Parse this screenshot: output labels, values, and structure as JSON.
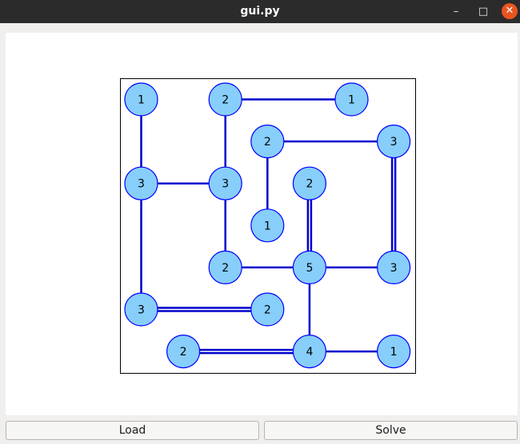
{
  "window": {
    "title": "gui.py",
    "minimize_glyph": "–",
    "maximize_glyph": "□",
    "close_glyph": "✕"
  },
  "buttons": {
    "load_label": "Load",
    "solve_label": "Solve"
  },
  "colors": {
    "island_fill": "#87cefa",
    "island_stroke": "#0000ff",
    "bridge": "#0000cd",
    "close_button": "#e95420",
    "titlebar": "#2b2b2b"
  },
  "puzzle": {
    "grid_size": 7,
    "islands": [
      {
        "row": 0,
        "col": 0,
        "value": "1"
      },
      {
        "row": 0,
        "col": 2,
        "value": "2"
      },
      {
        "row": 0,
        "col": 5,
        "value": "1"
      },
      {
        "row": 1,
        "col": 3,
        "value": "2"
      },
      {
        "row": 1,
        "col": 6,
        "value": "3"
      },
      {
        "row": 2,
        "col": 0,
        "value": "3"
      },
      {
        "row": 2,
        "col": 2,
        "value": "3"
      },
      {
        "row": 2,
        "col": 4,
        "value": "2"
      },
      {
        "row": 3,
        "col": 3,
        "value": "1"
      },
      {
        "row": 4,
        "col": 2,
        "value": "2"
      },
      {
        "row": 4,
        "col": 4,
        "value": "5"
      },
      {
        "row": 4,
        "col": 6,
        "value": "3"
      },
      {
        "row": 5,
        "col": 0,
        "value": "3"
      },
      {
        "row": 5,
        "col": 3,
        "value": "2"
      },
      {
        "row": 6,
        "col": 1,
        "value": "2"
      },
      {
        "row": 6,
        "col": 4,
        "value": "4"
      },
      {
        "row": 6,
        "col": 6,
        "value": "1"
      }
    ],
    "bridges": [
      {
        "from": [
          0,
          0
        ],
        "to": [
          2,
          0
        ],
        "count": 1
      },
      {
        "from": [
          0,
          2
        ],
        "to": [
          0,
          5
        ],
        "count": 1
      },
      {
        "from": [
          0,
          2
        ],
        "to": [
          2,
          2
        ],
        "count": 1
      },
      {
        "from": [
          1,
          3
        ],
        "to": [
          1,
          6
        ],
        "count": 1
      },
      {
        "from": [
          1,
          3
        ],
        "to": [
          3,
          3
        ],
        "count": 1
      },
      {
        "from": [
          1,
          6
        ],
        "to": [
          4,
          6
        ],
        "count": 2
      },
      {
        "from": [
          2,
          0
        ],
        "to": [
          2,
          2
        ],
        "count": 1
      },
      {
        "from": [
          2,
          0
        ],
        "to": [
          5,
          0
        ],
        "count": 1
      },
      {
        "from": [
          2,
          2
        ],
        "to": [
          4,
          2
        ],
        "count": 1
      },
      {
        "from": [
          2,
          4
        ],
        "to": [
          4,
          4
        ],
        "count": 2
      },
      {
        "from": [
          4,
          2
        ],
        "to": [
          4,
          4
        ],
        "count": 1
      },
      {
        "from": [
          4,
          4
        ],
        "to": [
          4,
          6
        ],
        "count": 1
      },
      {
        "from": [
          4,
          4
        ],
        "to": [
          6,
          4
        ],
        "count": 1
      },
      {
        "from": [
          5,
          0
        ],
        "to": [
          5,
          3
        ],
        "count": 2
      },
      {
        "from": [
          6,
          1
        ],
        "to": [
          6,
          4
        ],
        "count": 2
      },
      {
        "from": [
          6,
          4
        ],
        "to": [
          6,
          6
        ],
        "count": 1
      }
    ]
  }
}
